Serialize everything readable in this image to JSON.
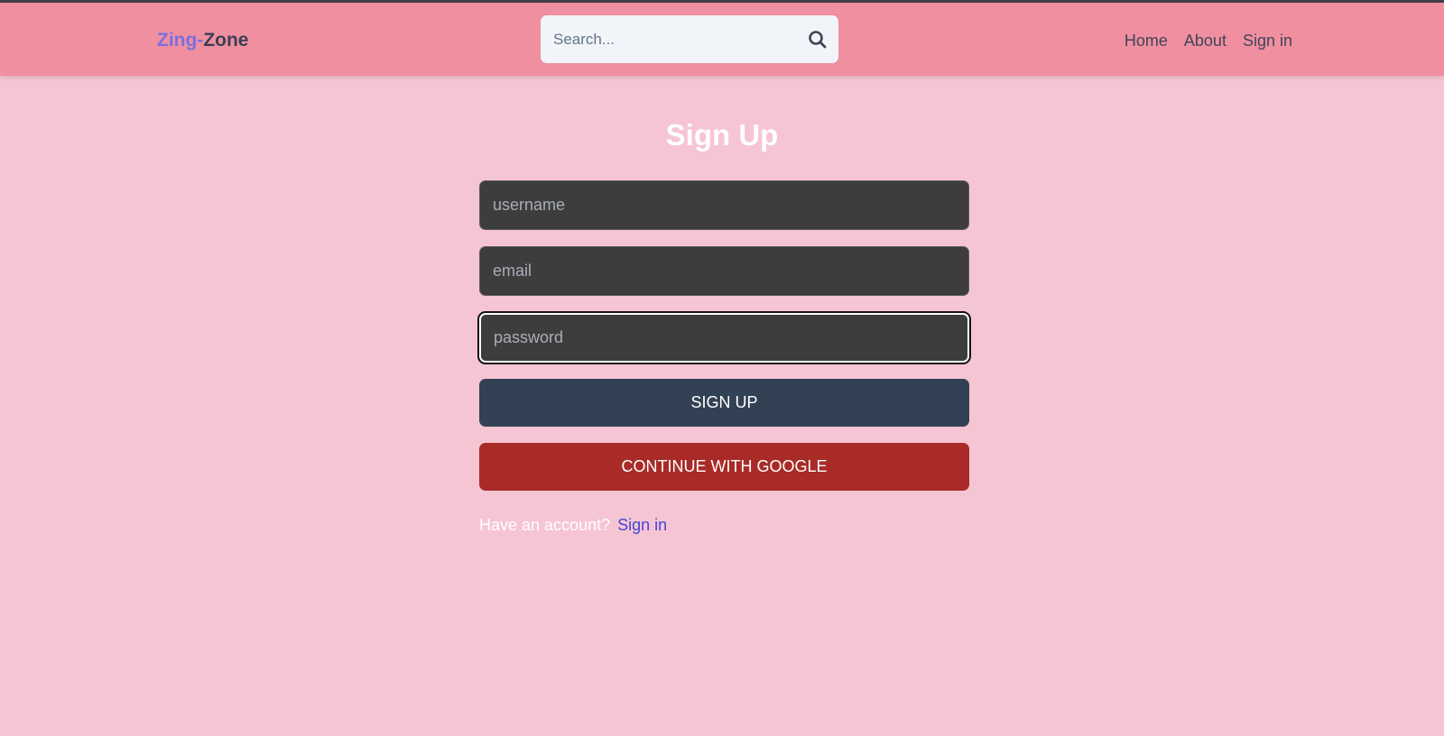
{
  "header": {
    "logo_part1": "Zing-",
    "logo_part2": "Zone",
    "search_placeholder": "Search...",
    "nav": [
      "Home",
      "About",
      "Sign in"
    ]
  },
  "form": {
    "title": "Sign Up",
    "username_placeholder": "username",
    "email_placeholder": "email",
    "password_placeholder": "password",
    "signup_label": "SIGN UP",
    "google_label": "CONTINUE WITH GOOGLE",
    "have_account_text": "Have an account?",
    "signin_link": "Sign in"
  },
  "colors": {
    "page_bg": "#f6c5d4",
    "header_bg": "#f08fa0",
    "signup_button": "#334155",
    "google_button": "#a92b27",
    "link": "#4545d8"
  },
  "icons": {
    "search": "search-icon"
  }
}
